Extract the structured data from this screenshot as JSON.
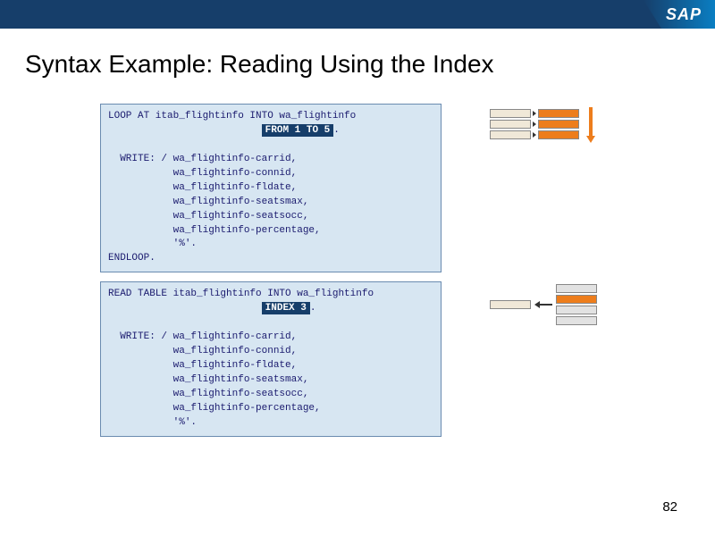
{
  "logo": "SAP",
  "title": "Syntax Example: Reading Using the Index",
  "code1": {
    "line1a": "LOOP AT itab_flightinfo INTO wa_flightinfo",
    "highlight": "FROM 1 TO 5",
    "period1": ".",
    "body": "  WRITE: / wa_flightinfo-carrid,\n           wa_flightinfo-connid,\n           wa_flightinfo-fldate,\n           wa_flightinfo-seatsmax,\n           wa_flightinfo-seatsocc,\n           wa_flightinfo-percentage,\n           '%'.\nENDLOOP."
  },
  "code2": {
    "line1a": "READ TABLE itab_flightinfo INTO wa_flightinfo",
    "highlight": "INDEX 3",
    "period1": ".",
    "body": "  WRITE: / wa_flightinfo-carrid,\n           wa_flightinfo-connid,\n           wa_flightinfo-fldate,\n           wa_flightinfo-seatsmax,\n           wa_flightinfo-seatsocc,\n           wa_flightinfo-percentage,\n           '%'."
  },
  "pageNumber": "82"
}
